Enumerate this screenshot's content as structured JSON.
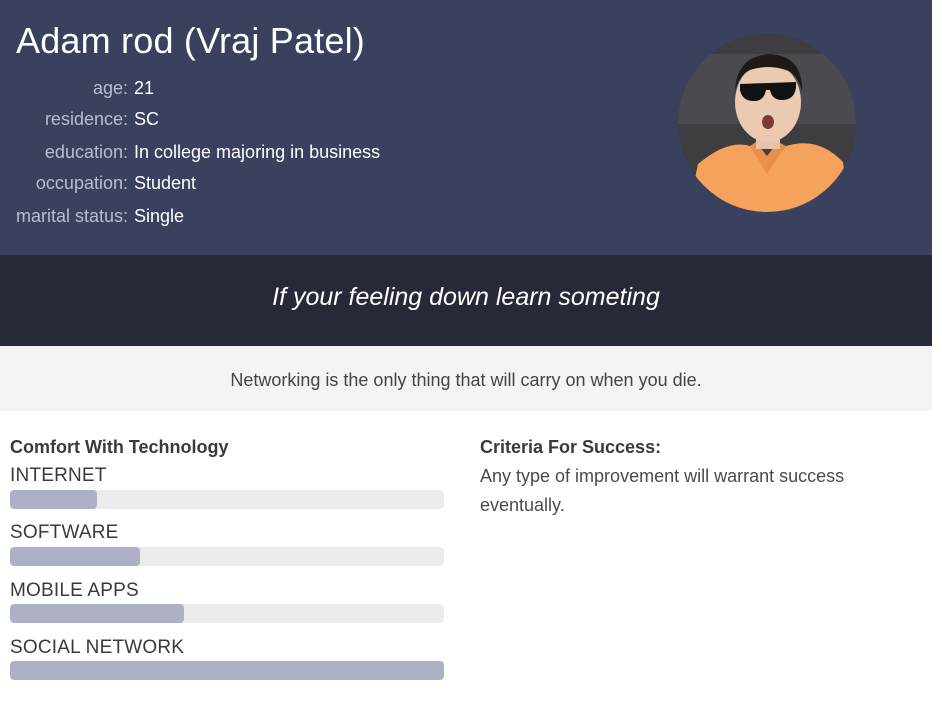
{
  "profile": {
    "name": "Adam rod (Vraj Patel)",
    "fields": [
      {
        "label": "age:",
        "value": "21"
      },
      {
        "label": "residence:",
        "value": "SC"
      },
      {
        "label": "education:",
        "value": "In college majoring in business"
      },
      {
        "label": "occupation:",
        "value": "Student"
      },
      {
        "label": "marital status:",
        "value": "Single"
      }
    ]
  },
  "quote": "If your feeling down learn someting",
  "tagline": "Networking is the only thing that will carry on when you die.",
  "technology": {
    "title": "Comfort With Technology",
    "skills": [
      {
        "label": "INTERNET",
        "level": 0.2
      },
      {
        "label": "SOFTWARE",
        "level": 0.3
      },
      {
        "label": "MOBILE APPS",
        "level": 0.4
      },
      {
        "label": "SOCIAL NETWORK",
        "level": 1.0
      }
    ]
  },
  "criteria": {
    "title": "Criteria For Success:",
    "text": "Any type of improvement will warrant success eventually."
  },
  "colors": {
    "header_bg": "#39415e",
    "quote_bg": "#262a38",
    "bar_fill": "#aeb0c6",
    "bar_track": "#ececec"
  }
}
